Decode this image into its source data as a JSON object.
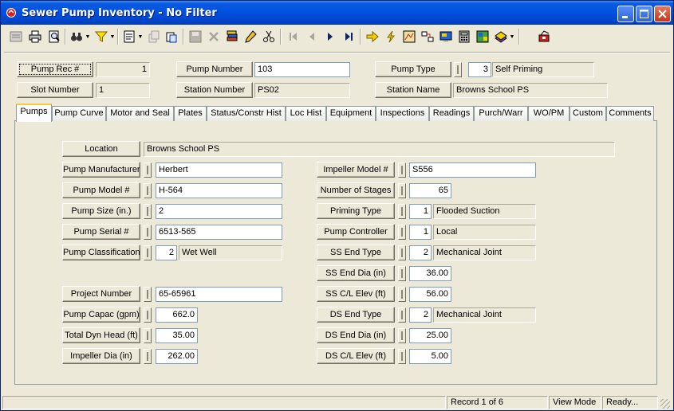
{
  "window": {
    "title": "Sewer Pump Inventory - No Filter"
  },
  "toolbar": {
    "tools": [
      "new-record-icon",
      "print-icon",
      "print-preview-icon",
      "binoculars-find-icon",
      "filter-icon",
      "new-form-icon",
      "copy-record-icon",
      "paste-record-icon",
      "save-icon",
      "delete-icon",
      "stack-report-icon",
      "edit-pencil-icon",
      "cut-scissors-icon",
      "first-record-icon",
      "previous-record-icon",
      "next-record-icon",
      "last-record-icon",
      "goto-arrow-icon",
      "lightning-icon",
      "map-icon",
      "link-icon",
      "monitor-icon",
      "calculator-icon",
      "gis-map-icon",
      "books-icon",
      "exit-icon"
    ]
  },
  "header": {
    "pump_rec_label": "Pump Rec #",
    "pump_rec_value": "1",
    "slot_number_label": "Slot Number",
    "slot_number_value": "1",
    "pump_number_label": "Pump Number",
    "pump_number_value": "103",
    "station_number_label": "Station Number",
    "station_number_value": "PS02",
    "pump_type_label": "Pump Type",
    "pump_type_code": "3",
    "pump_type_value": "Self Priming",
    "station_name_label": "Station Name",
    "station_name_value": "Browns School PS"
  },
  "tabs": [
    "Pumps",
    "Pump Curve",
    "Motor and Seal",
    "Plates",
    "Status/Constr Hist",
    "Loc Hist",
    "Equipment",
    "Inspections",
    "Readings",
    "Purch/Warr",
    "WO/PM",
    "Custom",
    "Comments"
  ],
  "active_tab": "Pumps",
  "pumps": {
    "location_label": "Location",
    "location_value": "Browns School PS",
    "manufacturer_label": "Pump Manufacturer",
    "manufacturer_value": "Herbert",
    "model_label": "Pump Model #",
    "model_value": "H-564",
    "size_label": "Pump Size (in.)",
    "size_value": "2",
    "serial_label": "Pump Serial #",
    "serial_value": "6513-565",
    "classification_label": "Pump Classification",
    "classification_code": "2",
    "classification_value": "Wet Well",
    "project_label": "Project Number",
    "project_value": "65-65961",
    "capac_label": "Pump Capac (gpm)",
    "capac_value": "662.0",
    "dyn_head_label": "Total Dyn Head (ft)",
    "dyn_head_value": "35.00",
    "impeller_dia_label": "Impeller Dia (in)",
    "impeller_dia_value": "262.00",
    "impeller_model_label": "Impeller Model #",
    "impeller_model_value": "S556",
    "stages_label": "Number of Stages",
    "stages_value": "65",
    "priming_label": "Priming Type",
    "priming_code": "1",
    "priming_value": "Flooded Suction",
    "controller_label": "Pump Controller",
    "controller_code": "1",
    "controller_value": "Local",
    "ss_end_type_label": "SS End Type",
    "ss_end_type_code": "2",
    "ss_end_type_value": "Mechanical Joint",
    "ss_end_dia_label": "SS End Dia (in)",
    "ss_end_dia_value": "36.00",
    "ss_cl_elev_label": "SS C/L Elev (ft)",
    "ss_cl_elev_value": "56.00",
    "ds_end_type_label": "DS End Type",
    "ds_end_type_code": "2",
    "ds_end_type_value": "Mechanical Joint",
    "ds_end_dia_label": "DS End Dia (in)",
    "ds_end_dia_value": "25.00",
    "ds_cl_elev_label": "DS C/L Elev (ft)",
    "ds_cl_elev_value": "5.00"
  },
  "status": {
    "record": "Record 1 of 6",
    "mode": "View Mode",
    "state": "Ready..."
  }
}
